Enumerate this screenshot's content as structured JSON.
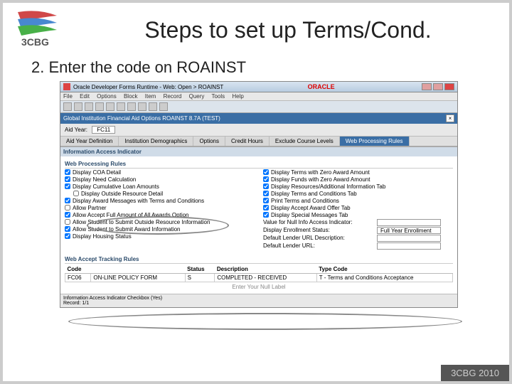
{
  "slide": {
    "title": "Steps to set up Terms/Cond.",
    "step_text": "2.  Enter the code on ROAINST",
    "footer": "3CBG 2010"
  },
  "window": {
    "title": "Oracle Developer Forms Runtime - Web: Open > ROAINST",
    "brand": "ORACLE",
    "menu": [
      "File",
      "Edit",
      "Options",
      "Block",
      "Item",
      "Record",
      "Query",
      "Tools",
      "Help"
    ],
    "breadcrumb": "Global Institution Financial Aid Options  ROAINST  8.7A  (TEST)",
    "aid_year_label": "Aid Year:",
    "aid_year_value": "FC11",
    "tabs": [
      "Aid Year Definition",
      "Institution Demographics",
      "Options",
      "Credit Hours",
      "Exclude Course Levels",
      "Web Processing Rules"
    ],
    "section1": "Information Access Indicator",
    "section2": "Web Processing Rules",
    "left_checks": [
      {
        "label": "Display COA Detail",
        "checked": true
      },
      {
        "label": "Display Need Calculation",
        "checked": true
      },
      {
        "label": "Display Cumulative Loan Amounts",
        "checked": true
      },
      {
        "label": "Display Outside Resource Detail",
        "checked": false,
        "indent": true
      },
      {
        "label": "Display Award Messages with Terms and Conditions",
        "checked": true
      },
      {
        "label": "Allow Partner",
        "checked": false
      },
      {
        "label": "Allow Accept Full Amount of All Awards Option",
        "checked": true
      },
      {
        "label": "Allow Student to Submit Outside Resource Information",
        "checked": false
      },
      {
        "label": "Allow Student to Submit Award Information",
        "checked": true
      },
      {
        "label": "Display Housing Status",
        "checked": true
      }
    ],
    "right_checks": [
      {
        "label": "Display Terms with Zero Award Amount",
        "checked": true
      },
      {
        "label": "Display Funds with Zero Award Amount",
        "checked": true
      },
      {
        "label": "Display Resources/Additional Information Tab",
        "checked": true
      },
      {
        "label": "Display Terms and Conditions Tab",
        "checked": true
      },
      {
        "label": "Print Terms and Conditions",
        "checked": true
      },
      {
        "label": "Display Accept Award Offer Tab",
        "checked": true
      },
      {
        "label": "Display Special Messages Tab",
        "checked": true
      }
    ],
    "pairs": [
      {
        "label": "Value for Null Info Access Indicator:",
        "value": ""
      },
      {
        "label": "Display Enrollment Status:",
        "value": "Full Year Enrollment"
      },
      {
        "label": "Default Lender URL Description:",
        "value": ""
      },
      {
        "label": "Default Lender URL:",
        "value": ""
      }
    ],
    "section3": "Web Accept Tracking Rules",
    "table": {
      "headers": [
        "Code",
        "",
        "Status",
        "Description",
        "Type Code"
      ],
      "row": {
        "code": "FC06",
        "desc1": "ON-LINE POLICY FORM",
        "status": "S",
        "desc2": "COMPLETED - RECEIVED",
        "type": "T - Terms and Conditions Acceptance"
      },
      "user_label": "Enter Your Null Label"
    },
    "statusbar": {
      "line1": "Information Access Indicator Checkbox (Yes)",
      "line2": "Record: 1/1"
    }
  }
}
